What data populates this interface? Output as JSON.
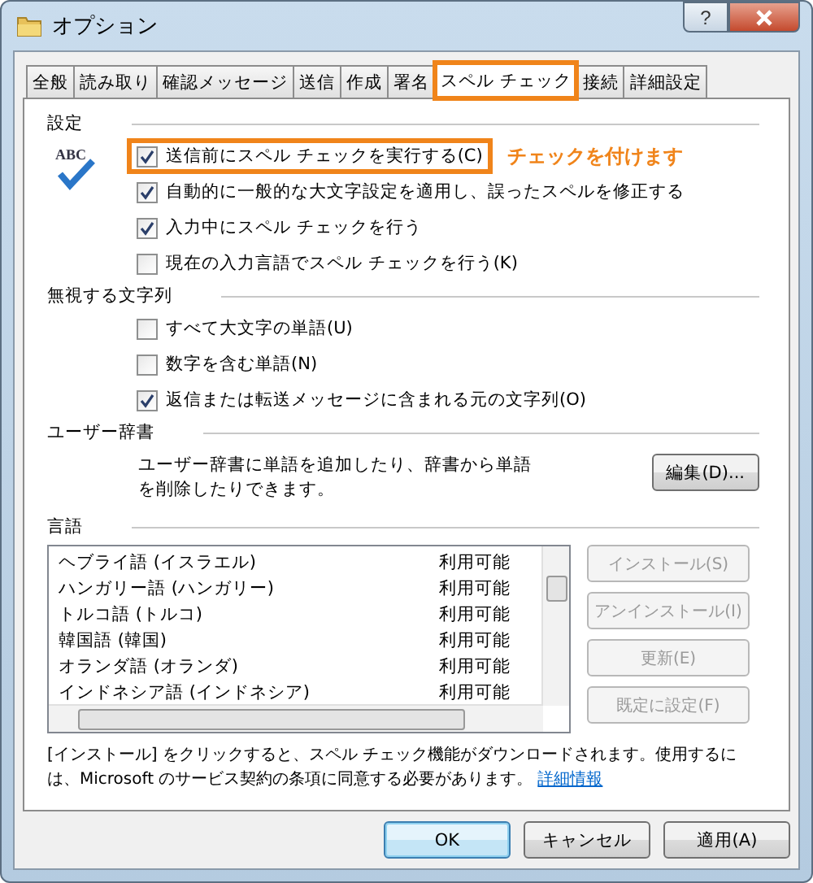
{
  "window": {
    "title": "オプション",
    "help": "?"
  },
  "tabs": [
    {
      "label": "全般",
      "selected": false,
      "highlighted": false
    },
    {
      "label": "読み取り",
      "selected": false,
      "highlighted": false
    },
    {
      "label": "確認メッセージ",
      "selected": false,
      "highlighted": false
    },
    {
      "label": "送信",
      "selected": false,
      "highlighted": false
    },
    {
      "label": "作成",
      "selected": false,
      "highlighted": false
    },
    {
      "label": "署名",
      "selected": false,
      "highlighted": false
    },
    {
      "label": "スペル チェック",
      "selected": true,
      "highlighted": true
    },
    {
      "label": "接続",
      "selected": false,
      "highlighted": false
    },
    {
      "label": "詳細設定",
      "selected": false,
      "highlighted": false
    }
  ],
  "settings": {
    "title": "設定",
    "icon_text": "ABC",
    "checkboxes": [
      {
        "label": "送信前にスペル チェックを実行する(C)",
        "checked": true,
        "highlighted": true
      },
      {
        "label": "自動的に一般的な大文字設定を適用し、誤ったスペルを修正する",
        "checked": true,
        "highlighted": false
      },
      {
        "label": "入力中にスペル チェックを行う",
        "checked": true,
        "highlighted": false
      },
      {
        "label": "現在の入力言語でスペル チェックを行う(K)",
        "checked": false,
        "highlighted": false
      }
    ]
  },
  "annotation": "チェックを付けます",
  "ignore": {
    "title": "無視する文字列",
    "checkboxes": [
      {
        "label": "すべて大文字の単語(U)",
        "checked": false,
        "highlighted": false
      },
      {
        "label": "数字を含む単語(N)",
        "checked": false,
        "highlighted": false
      },
      {
        "label": "返信または転送メッセージに含まれる元の文字列(O)",
        "checked": true,
        "highlighted": false
      }
    ]
  },
  "user_dictionary": {
    "title": "ユーザー辞書",
    "description": "ユーザー辞書に単語を追加したり、辞書から単語を削除したりできます。",
    "button": "編集(D)..."
  },
  "languages": {
    "title": "言語",
    "rows": [
      {
        "name": "ヘブライ語 (イスラエル)",
        "status": "利用可能"
      },
      {
        "name": "ハンガリー語 (ハンガリー)",
        "status": "利用可能"
      },
      {
        "name": "トルコ語 (トルコ)",
        "status": "利用可能"
      },
      {
        "name": "韓国語 (韓国)",
        "status": "利用可能"
      },
      {
        "name": "オランダ語 (オランダ)",
        "status": "利用可能"
      },
      {
        "name": "インドネシア語 (インドネシア)",
        "status": "利用可能"
      }
    ],
    "buttons": [
      {
        "label": "インストール(S)",
        "disabled": true
      },
      {
        "label": "アンインストール(I)",
        "disabled": true
      },
      {
        "label": "更新(E)",
        "disabled": true
      },
      {
        "label": "既定に設定(F)",
        "disabled": true
      }
    ]
  },
  "note": {
    "text": "[インストール] をクリックすると、スペル チェック機能がダウンロードされます。使用するには、Microsoft のサービス契約の条項に同意する必要があります。",
    "link": "詳細情報"
  },
  "footer_buttons": [
    {
      "label": "OK",
      "default": true
    },
    {
      "label": "キャンセル",
      "default": false
    },
    {
      "label": "適用(A)",
      "default": false
    }
  ]
}
